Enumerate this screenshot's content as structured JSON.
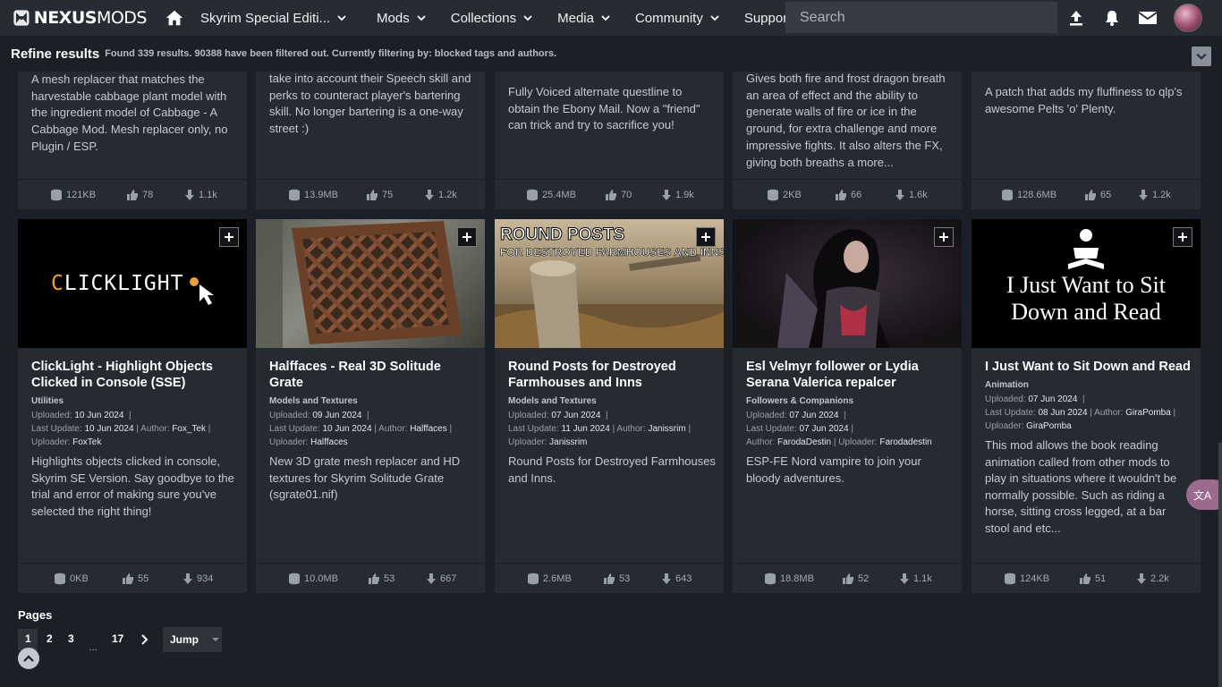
{
  "nav": {
    "logo_bold": "NEXUS",
    "logo_rest": "MODS",
    "game": "Skyrim Special Editi...",
    "items": [
      "Mods",
      "Collections",
      "Media",
      "Community",
      "Support"
    ],
    "search_placeholder": "Search"
  },
  "refine": {
    "title": "Refine results",
    "info": "Found 339 results. 90388 have been filtered out. Currently filtering by: blocked tags and authors."
  },
  "top_cards": [
    {
      "desc": "A mesh replacer that matches the harvestable cabbage plant model with the ingredient model of Cabbage - A Cabbage Mod. Mesh replacer only, no Plugin / ESP.",
      "size": "121KB",
      "endorse": "78",
      "downloads": "1.1k"
    },
    {
      "desc": "take into account their Speech skill and perks to counteract player's bartering skill. No longer bartering is a one-way street :)",
      "size": "13.9MB",
      "endorse": "75",
      "downloads": "1.2k"
    },
    {
      "desc": "Fully Voiced alternate questline to obtain the Ebony Mail. Now a \"friend\" can trick and try to sacrifice you!",
      "size": "25.4MB",
      "endorse": "70",
      "downloads": "1.9k"
    },
    {
      "desc": "Gives both fire and frost dragon breath an area of effect and the ability to generate walls of fire or ice in the ground, for extra challenge and more impressive fights. It also alters the FX, giving both breaths a more...",
      "size": "2KB",
      "endorse": "66",
      "downloads": "1.6k"
    },
    {
      "desc": "A patch that adds my fluffiness to qlp's awesome Pelts 'o' Plenty.",
      "size": "128.6MB",
      "endorse": "65",
      "downloads": "1.2k"
    }
  ],
  "cards": [
    {
      "thumb_text": "CLICKLIGHT",
      "title": "ClickLight - Highlight Objects Clicked in Console (SSE)",
      "category": "Utilities",
      "uploaded_label": "Uploaded:",
      "uploaded": "10 Jun 2024",
      "update_label": "Last Update:",
      "update": "10 Jun 2024",
      "author_label": "Author:",
      "author": "Fox_Tek",
      "uploader_label": "Uploader:",
      "uploader": "FoxTek",
      "desc": "Highlights objects clicked in console, Skyrim SE Version. Say goodbye to the trial and error of making sure you've selected the right thing!",
      "size": "0KB",
      "endorse": "55",
      "downloads": "934"
    },
    {
      "title": "Halffaces - Real 3D Solitude Grate",
      "category": "Models and Textures",
      "uploaded_label": "Uploaded:",
      "uploaded": "09 Jun 2024",
      "update_label": "Last Update:",
      "update": "10 Jun 2024",
      "author_label": "Author:",
      "author": "Halffaces",
      "uploader_label": "Uploader:",
      "uploader": "Halffaces",
      "desc": "New 3D grate mesh replacer and HD textures for Skyrim Solitude Grate (sgrate01.nif)",
      "size": "10.0MB",
      "endorse": "53",
      "downloads": "667"
    },
    {
      "thumb_line1": "ROUND POSTS",
      "thumb_line2": "FOR DESTROYED FARMHOUSES AND INNS",
      "title": "Round Posts for Destroyed Farmhouses and Inns",
      "category": "Models and Textures",
      "uploaded_label": "Uploaded:",
      "uploaded": "07 Jun 2024",
      "update_label": "Last Update:",
      "update": "11 Jun 2024",
      "author_label": "Author:",
      "author": "Janissrim",
      "uploader_label": "Uploader:",
      "uploader": "Janissrim",
      "desc": "Round Posts for Destroyed Farmhouses and Inns.",
      "size": "2.6MB",
      "endorse": "53",
      "downloads": "643"
    },
    {
      "title": "Esl Velmyr follower or Lydia Serana Valerica repalcer",
      "category": "Followers & Companions",
      "uploaded_label": "Uploaded:",
      "uploaded": "07 Jun 2024",
      "update_label": "Last Update:",
      "update": "07 Jun 2024",
      "author_label": "Author:",
      "author": "FarodaDestin",
      "uploader_label": "Uploader:",
      "uploader": "Farodadestin",
      "desc": "ESP-FE Nord vampire to join your bloody adventures.",
      "size": "18.8MB",
      "endorse": "52",
      "downloads": "1.1k"
    },
    {
      "thumb_line1": "I Just Want to Sit",
      "thumb_line2": "Down and Read",
      "title": "I Just Want to Sit Down and Read",
      "category": "Animation",
      "uploaded_label": "Uploaded:",
      "uploaded": "07 Jun 2024",
      "update_label": "Last Update:",
      "update": "08 Jun 2024",
      "author_label": "Author:",
      "author": "GiraPomba",
      "uploader_label": "Uploader:",
      "uploader": "GiraPomba",
      "desc": "This mod allows the book reading animation called from other mods to play in situations where it wouldn't be normally possible. Such as riding a horse, sitting cross legged, at a bar stool and etc...",
      "size": "124KB",
      "endorse": "51",
      "downloads": "2.2k"
    }
  ],
  "pagination": {
    "label": "Pages",
    "pages": [
      "1",
      "2",
      "3",
      "...",
      "17"
    ],
    "jump": "Jump"
  },
  "translate_fab": "文A",
  "colors": {
    "bg": "#1b1f27",
    "card": "#252a33",
    "nav": "#272b33",
    "accent": "#d98f40"
  }
}
